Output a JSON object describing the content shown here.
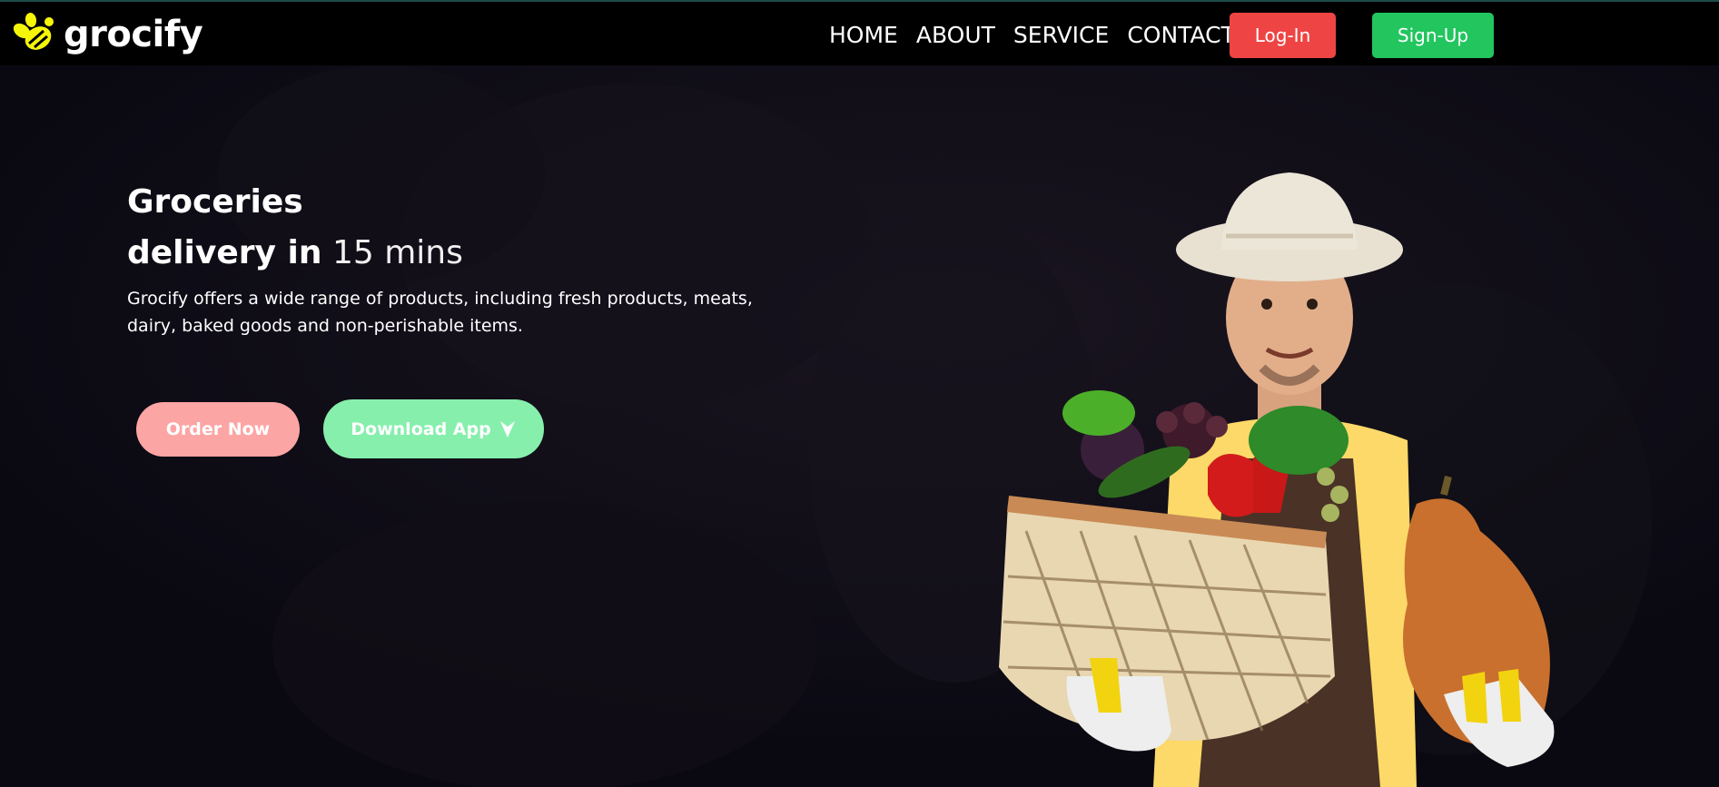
{
  "brand": {
    "name": "grocify",
    "logo_icon": "bee-icon",
    "logo_color": "#f5f50a"
  },
  "nav": {
    "links": [
      "HOME",
      "ABOUT",
      "SERVICE",
      "CONTACT"
    ],
    "login_label": "Log-In",
    "signup_label": "Sign-Up"
  },
  "hero": {
    "title_line1": "Groceries",
    "title_line2_bold": "delivery in",
    "title_line2_thin": "15 mins",
    "description": "Grocify offers a wide range of products, including fresh products, meats, dairy, baked goods and non-perishable items.",
    "order_button": "Order Now",
    "download_button": "Download App",
    "download_icon": "arrow-down-icon",
    "image_subject": "farmer-holding-vegetable-basket-and-squash"
  },
  "colors": {
    "navbar_bg": "#000000",
    "hero_bg": "#0b0a14",
    "login_bg": "#ef4444",
    "signup_bg": "#22c55e",
    "order_bg": "#fca5a5",
    "download_bg": "#86efac"
  }
}
